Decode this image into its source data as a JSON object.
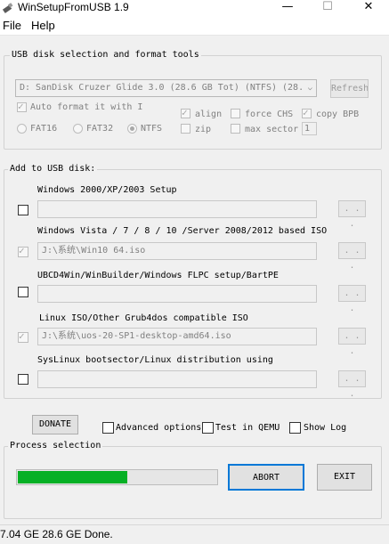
{
  "window": {
    "title": "WinSetupFromUSB 1.9",
    "controls": {
      "minimize": "—",
      "maximize": "☐",
      "close": "✕"
    }
  },
  "menu": {
    "items": [
      "File",
      "Help"
    ]
  },
  "usb_tools": {
    "group_title": "USB disk selection and format tools",
    "disk_selected": "D: SanDisk Cruzer Glide 3.0 (28.6 GB Tot) (NTFS) (28.",
    "refresh_label": "Refresh",
    "auto_format_label": "Auto format it with I",
    "auto_format_checked": true,
    "fs_options": [
      "FAT16",
      "FAT32",
      "NTFS"
    ],
    "fs_selected": "NTFS",
    "align_label": "align",
    "align_checked": true,
    "force_chs_label": "force CHS",
    "force_chs_checked": false,
    "copy_bpb_label": "copy BPB",
    "copy_bpb_checked": true,
    "zip_label": "zip",
    "zip_checked": false,
    "max_sector_label": "max sector",
    "max_sector_checked": false,
    "max_sector_value": "1"
  },
  "add_to_usb": {
    "group_title": "Add to USB disk:",
    "rows": [
      {
        "label": "Windows 2000/XP/2003 Setup",
        "checked": false,
        "path": "",
        "browse": ". . ."
      },
      {
        "label": "Windows Vista / 7 / 8 / 10 /Server 2008/2012 based ISO",
        "checked": true,
        "path": "J:\\系统\\Win10 64.iso",
        "browse": ". . ."
      },
      {
        "label": "UBCD4Win/WinBuilder/Windows FLPC setup/BartPE",
        "checked": false,
        "path": "",
        "browse": ". . ."
      },
      {
        "label": "Linux ISO/Other Grub4dos compatible ISO",
        "checked": true,
        "path": "J:\\系统\\uos-20-SP1-desktop-amd64.iso",
        "browse": ". . ."
      },
      {
        "label": "SysLinux bootsector/Linux distribution using",
        "checked": false,
        "path": "",
        "browse": ". . ."
      }
    ]
  },
  "bottom": {
    "donate_label": "DONATE",
    "advanced_options_label": "Advanced options",
    "test_qemu_label": "Test in QEMU",
    "show_log_label": "Show Log",
    "process_title": "Process selection",
    "progress_fraction": 0.55,
    "abort_label": "ABORT",
    "exit_label": "EXIT"
  },
  "status": {
    "text": "7.04 GE 28.6 GE Done."
  },
  "colors": {
    "progress": "#06b025",
    "focus_border": "#0078d7"
  }
}
